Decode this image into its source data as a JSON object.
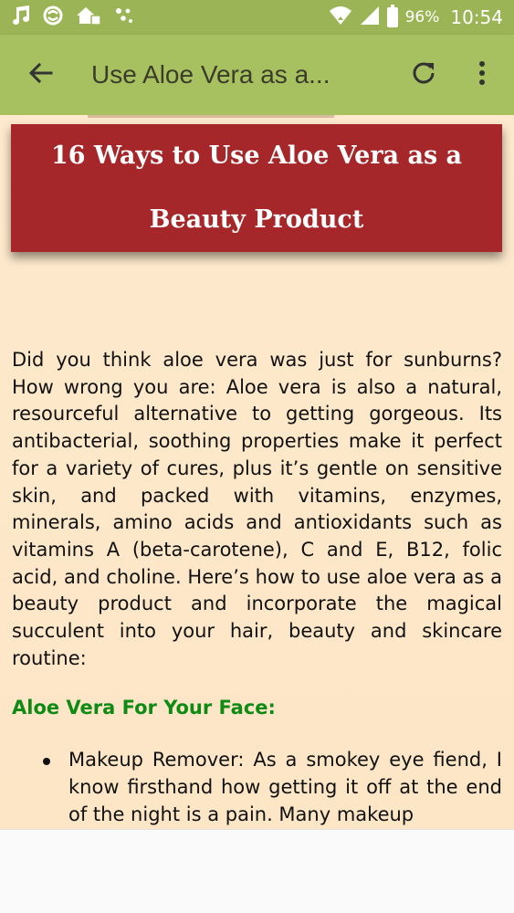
{
  "status_bar": {
    "icons": [
      "music-note-icon",
      "sync-icon",
      "vpn-icon",
      "dots-icon"
    ],
    "battery_percent": "96%",
    "time": "10:54"
  },
  "app_bar": {
    "title": "Use Aloe Vera as a...",
    "back_icon": "arrow-back-icon",
    "refresh_icon": "refresh-icon",
    "menu_icon": "more-vertical-icon"
  },
  "article": {
    "heading": "16 Ways to Use Aloe Vera as a Beauty Product",
    "intro": "Did you think aloe vera was just for sunburns? How wrong you are: Aloe vera is also a natural, resourceful alternative to getting gorgeous. Its antibacterial, soothing properties make it perfect for a variety of cures, plus it’s gentle on sensitive skin, and packed with vitamins, enzymes, minerals, amino acids and antioxidants such as vitamins A (beta-carotene), C and E, B12, folic acid, and choline. Here’s how to use aloe vera as a beauty product and incorporate the magical succulent into your hair, beauty and skincare routine:",
    "section_title": "Aloe Vera For Your Face:",
    "bullets": [
      "Makeup Remover: As a smokey eye fiend, I know firsthand how getting it off at the end of the night is a pain. Many makeup"
    ]
  },
  "colors": {
    "status_bar": "#9bb556",
    "app_bar": "#a7c160",
    "title_card": "#a5272a",
    "section_heading": "#0f8a14",
    "background": "#fde9cd"
  }
}
